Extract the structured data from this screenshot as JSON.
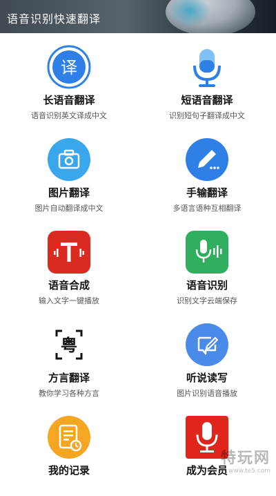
{
  "header": {
    "title": "语音识别快速翻译"
  },
  "features": [
    {
      "name": "长语音翻译",
      "desc": "语音识别英文译成中文",
      "icon": "translate-icon",
      "color": "#2e80e6"
    },
    {
      "name": "短语音翻译",
      "desc": "识别短句子翻译成中文",
      "icon": "microphone-icon",
      "color": "#2e80e6"
    },
    {
      "name": "图片翻译",
      "desc": "图片自动翻译成中文",
      "icon": "camera-icon",
      "color": "#3aa6ec"
    },
    {
      "name": "手输翻译",
      "desc": "多语言语种互相翻译",
      "icon": "pen-icon",
      "color": "#2e80e6"
    },
    {
      "name": "语音合成",
      "desc": "输入文字一键播放",
      "icon": "text-to-speech-icon",
      "color": "#d92b1f"
    },
    {
      "name": "语音识别",
      "desc": "识别文字云端保存",
      "icon": "voice-recognition-icon",
      "color": "#2fae5e"
    },
    {
      "name": "方言翻译",
      "desc": "教你学习各种方言",
      "icon": "dialect-icon",
      "color": "#111111",
      "icon_text": "粤"
    },
    {
      "name": "听说读写",
      "desc": "图片识别语音播放",
      "icon": "edit-note-icon",
      "color": "#4a8ae8"
    },
    {
      "name": "我的记录",
      "desc": "",
      "icon": "records-icon",
      "color": "#f5a623"
    },
    {
      "name": "成为会员",
      "desc": "",
      "icon": "vip-microphone-icon",
      "color": "#e0261c"
    }
  ],
  "watermark": {
    "text": "特玩网",
    "sub": "www.te5.com"
  }
}
